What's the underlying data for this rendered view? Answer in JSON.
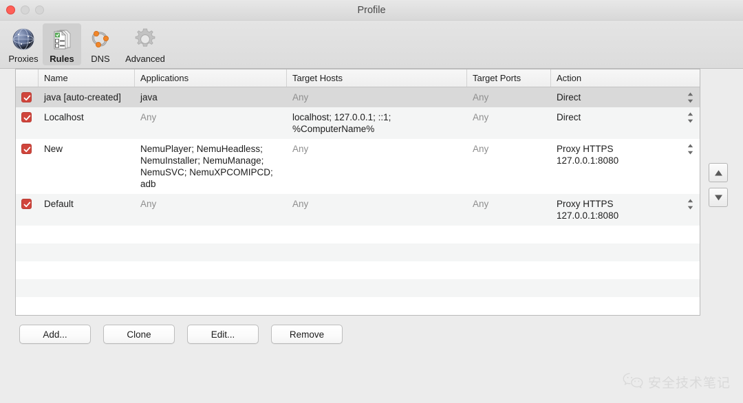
{
  "window": {
    "title": "Profile",
    "traffic_lights": [
      {
        "name": "close-button",
        "color": "#ff5f57"
      },
      {
        "name": "minimize-button",
        "color": "#d6d6d6"
      },
      {
        "name": "zoom-button",
        "color": "#d6d6d6"
      }
    ]
  },
  "toolbar": {
    "items": [
      {
        "label": "Proxies",
        "icon": "globe-icon",
        "selected": false
      },
      {
        "label": "Rules",
        "icon": "rules-icon",
        "selected": true
      },
      {
        "label": "DNS",
        "icon": "dns-icon",
        "selected": false
      },
      {
        "label": "Advanced",
        "icon": "gear-icon",
        "selected": false
      }
    ]
  },
  "table": {
    "columns": [
      "",
      "Name",
      "Applications",
      "Target Hosts",
      "Target Ports",
      "Action"
    ],
    "rows": [
      {
        "checked": true,
        "selected": true,
        "name": "java [auto-created]",
        "applications": "java",
        "applications_muted": false,
        "target_hosts": "Any",
        "target_hosts_muted": true,
        "target_ports": "Any",
        "target_ports_muted": true,
        "action": "Direct"
      },
      {
        "checked": true,
        "selected": false,
        "name": "Localhost",
        "applications": "Any",
        "applications_muted": true,
        "target_hosts": "localhost; 127.0.0.1; ::1; %ComputerName%",
        "target_hosts_muted": false,
        "target_ports": "Any",
        "target_ports_muted": true,
        "action": "Direct"
      },
      {
        "checked": true,
        "selected": false,
        "name": "New",
        "applications": "NemuPlayer; NemuHeadless; NemuInstaller; NemuManage; NemuSVC; NemuXPCOMIPCD; adb",
        "applications_muted": false,
        "target_hosts": "Any",
        "target_hosts_muted": true,
        "target_ports": "Any",
        "target_ports_muted": true,
        "action": "Proxy HTTPS\n127.0.0.1:8080"
      },
      {
        "checked": true,
        "selected": false,
        "name": "Default",
        "applications": "Any",
        "applications_muted": true,
        "target_hosts": "Any",
        "target_hosts_muted": true,
        "target_ports": "Any",
        "target_ports_muted": true,
        "action": "Proxy HTTPS\n127.0.0.1:8080"
      }
    ],
    "empty_row_count": 7
  },
  "reorder": {
    "move_up_label": "Move Up",
    "move_down_label": "Move Down"
  },
  "footer": {
    "buttons": [
      {
        "label": "Add...",
        "name": "add-button"
      },
      {
        "label": "Clone",
        "name": "clone-button"
      },
      {
        "label": "Edit...",
        "name": "edit-button"
      },
      {
        "label": "Remove",
        "name": "remove-button"
      }
    ]
  },
  "watermark": {
    "text": "安全技术笔记",
    "icon": "wechat-icon",
    "color": "#d2d2d2"
  }
}
